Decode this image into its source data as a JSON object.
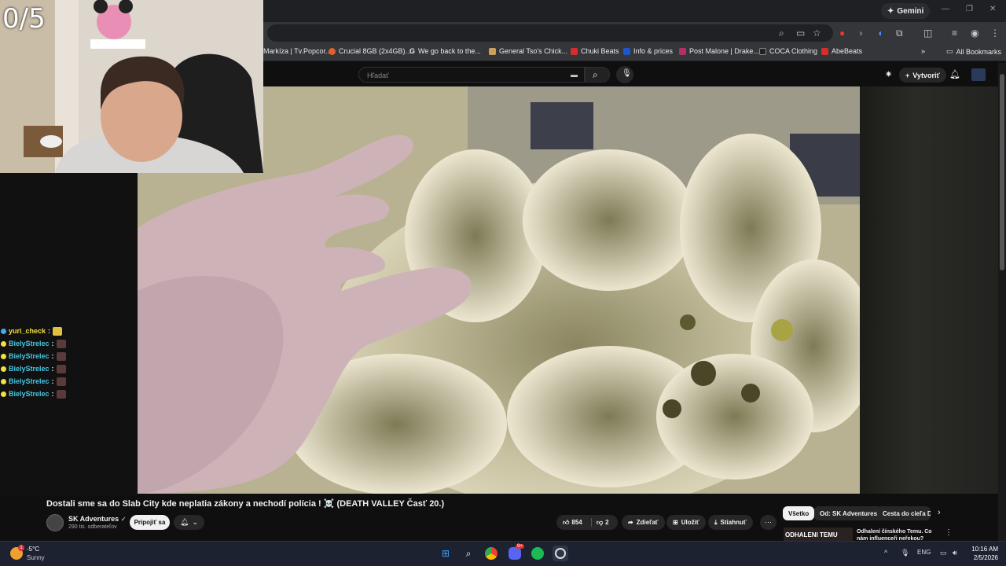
{
  "browser": {
    "gemini_label": "Gemini",
    "bookmarks": [
      {
        "label": "Markíza | Tv.Popcor...",
        "color": "#2b5cd6"
      },
      {
        "label": "Crucial 8GB (2x4GB)...",
        "color": "#e0622a"
      },
      {
        "label": "We go back to the...",
        "color": "#4285f4"
      },
      {
        "label": "General Tso's Chick...",
        "color": "#c9a25a"
      },
      {
        "label": "Chuki Beats",
        "color": "#d32f2f"
      },
      {
        "label": "Info & prices",
        "color": "#1e56c8"
      },
      {
        "label": "Post Malone | Drake...",
        "color": "#b0306a"
      },
      {
        "label": "COCA Clothing",
        "color": "#222222"
      },
      {
        "label": "AbeBeats",
        "color": "#d32f2f"
      }
    ],
    "all_bookmarks_label": "All Bookmarks"
  },
  "youtube": {
    "search_placeholder": "Hľadať",
    "create_label": "Vytvoriť",
    "video_title": "Dostali sme sa do Slab City kde neplatia zákony a nechodí polícia ! ☠️ (DEATH VALLEY Časť 20.)",
    "channel_name": "SK Adventures",
    "subscribers": "290 tis. odberateľov",
    "join_label": "Pripojiť sa",
    "likes": "854",
    "dislikes": "2",
    "share_label": "Zdieľať",
    "save_label": "Uložiť",
    "download_label": "Stiahnuť",
    "chips": [
      "Všetko",
      "Od: SK Adventures",
      "Cesta do cieľa Do"
    ],
    "reco_thumb_text": "ODHALENI TEMU",
    "reco_title": "Odhalení čínského Temu. Co nám influenceři neřekou?"
  },
  "stream": {
    "counter": "0/5",
    "chat": [
      {
        "user": "yuri_check",
        "color": "#f0e040",
        "badge": "#3fa9f5"
      },
      {
        "user": "BielyStrelec",
        "color": "#47c6e0",
        "badge": "#f0e040"
      },
      {
        "user": "BielyStrelec",
        "color": "#47c6e0",
        "badge": "#f0e040"
      },
      {
        "user": "BielyStrelec",
        "color": "#47c6e0",
        "badge": "#f0e040"
      },
      {
        "user": "BielyStrelec",
        "color": "#47c6e0",
        "badge": "#f0e040"
      },
      {
        "user": "BielyStrelec",
        "color": "#47c6e0",
        "badge": "#f0e040"
      }
    ]
  },
  "taskbar": {
    "temperature": "-5°C",
    "weather": "Sunny",
    "weather_badge": "1",
    "language": "ENG",
    "time": "10:16 AM",
    "date": "2/5/2026",
    "discord_badge": "9+"
  }
}
